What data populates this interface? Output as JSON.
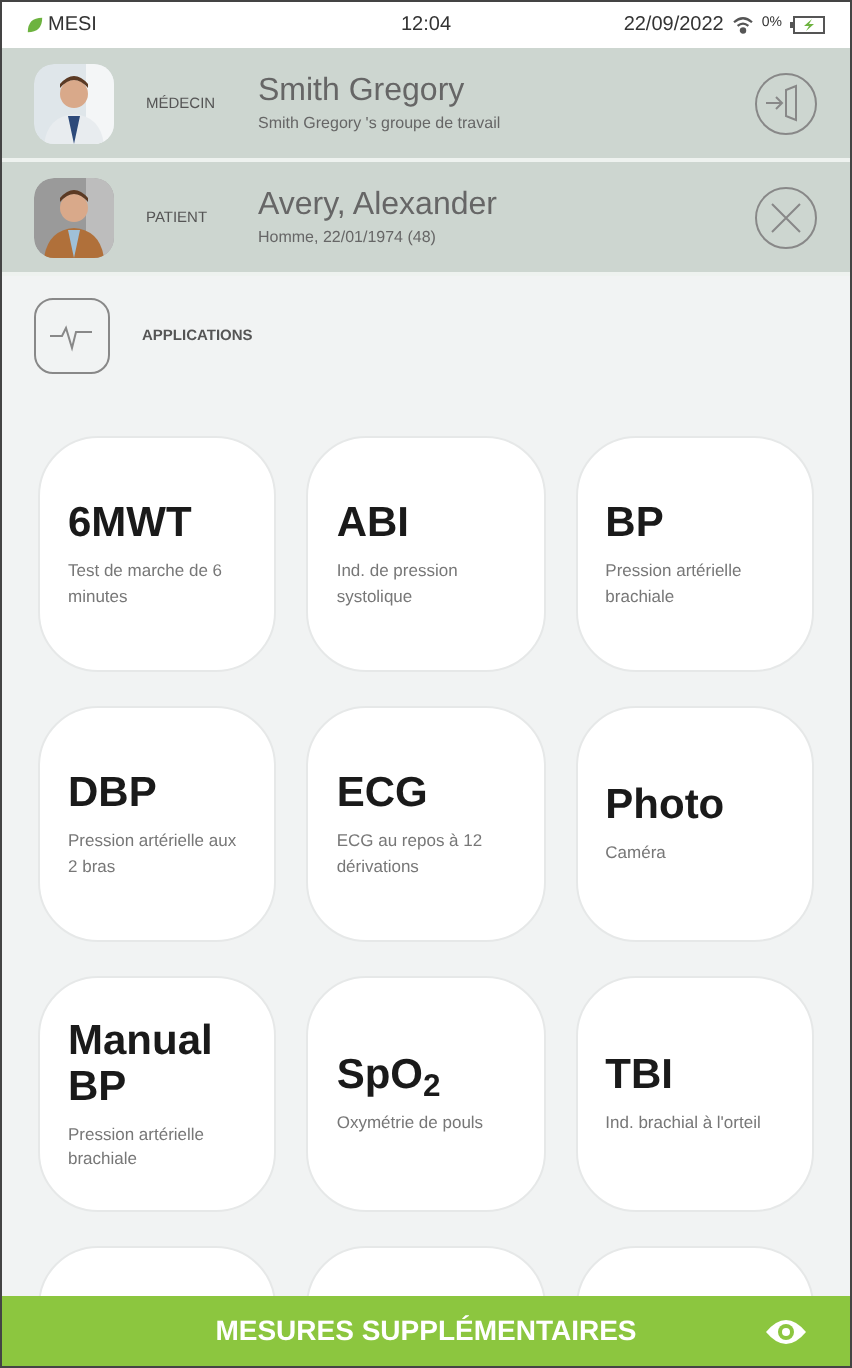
{
  "status_bar": {
    "brand": "MESI",
    "time": "12:04",
    "date": "22/09/2022",
    "battery": "0%"
  },
  "users": [
    {
      "kind": "doctor",
      "role": "MÉDECIN",
      "name": "Smith Gregory",
      "detail": "Smith Gregory 's groupe de travail"
    },
    {
      "kind": "patient",
      "role": "PATIENT",
      "name": "Avery, Alexander",
      "detail": "Homme, 22/01/1974 (48)"
    }
  ],
  "section": {
    "title": "APPLICATIONS"
  },
  "tiles": [
    {
      "kind": "app",
      "title": "6MWT",
      "subtitle": "Test de marche de 6 minutes"
    },
    {
      "kind": "app",
      "title": "ABI",
      "subtitle": "Ind. de pression systolique"
    },
    {
      "kind": "app",
      "title": "BP",
      "subtitle": "Pression artérielle brachiale"
    },
    {
      "kind": "app",
      "title": "DBP",
      "subtitle": "Pression artérielle aux 2 bras"
    },
    {
      "kind": "app",
      "title": "ECG",
      "subtitle": "ECG au repos à 12 dérivations"
    },
    {
      "kind": "app",
      "title": "Photo",
      "subtitle": "Caméra"
    },
    {
      "kind": "app",
      "title": "Manual BP",
      "subtitle": "Pression artérielle brachiale"
    },
    {
      "kind": "app",
      "title": "SpO$_{2}$",
      "subtitle": "Oxymétrie de pouls"
    },
    {
      "kind": "app",
      "title": "TBI",
      "subtitle": "Ind. brachial à l'orteil"
    },
    {
      "kind": "cut"
    },
    {
      "kind": "cut"
    },
    {
      "kind": "cut"
    }
  ],
  "bottom_button": {
    "label": "MESURES SUPPLÉMENTAIRES"
  }
}
